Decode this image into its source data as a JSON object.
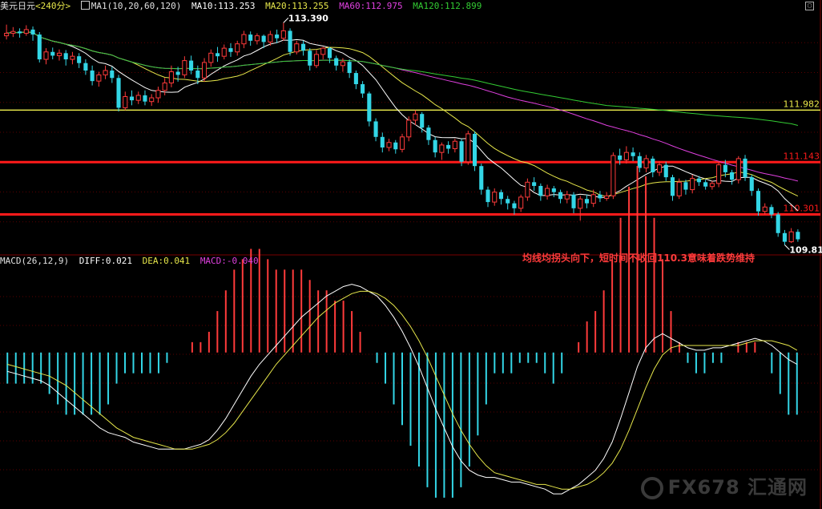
{
  "header": {
    "symbol": "美元日元",
    "period": "<240分>",
    "ma_label": "MA1(10,20,60,120)",
    "ma10": "MA10:113.253",
    "ma20": "MA20:113.255",
    "ma60": "MA60:112.975",
    "ma120": "MA120:112.899"
  },
  "macd_header": {
    "label": "MACD(26,12,9)",
    "diff": "DIFF:0.021",
    "dea": "DEA:0.041",
    "macd": "MACD:-0.040"
  },
  "annotation": "均线均拐头向下，短时间不收回110.3意味着跌势维持",
  "watermark": "FX678 汇通网",
  "colors": {
    "up": "#ff3b3b",
    "down": "#33d6e6",
    "ma10": "#ffffff",
    "ma20": "#e6e64a",
    "ma60": "#e040e0",
    "ma120": "#33cc33",
    "level_yellow": "#e6e64a",
    "level_red": "#ff1a1a",
    "diff": "#ffffff",
    "dea": "#e6e64a"
  },
  "chart_data": [
    {
      "type": "candlestick",
      "ylim": [
        109.7,
        113.55
      ],
      "price_labels": [
        {
          "value": 113.39,
          "text": "113.390"
        },
        {
          "value": 109.81,
          "text": "109.810"
        }
      ],
      "levels": [
        {
          "value": 111.982,
          "text": "111.982",
          "color": "yellow"
        },
        {
          "value": 111.143,
          "text": "111.143",
          "color": "red"
        },
        {
          "value": 110.301,
          "text": "110.301",
          "color": "red"
        }
      ],
      "candles": [
        [
          113.18,
          113.22,
          113.36,
          113.12
        ],
        [
          113.22,
          113.25,
          113.32,
          113.16
        ],
        [
          113.25,
          113.22,
          113.3,
          113.15
        ],
        [
          113.22,
          113.28,
          113.35,
          113.18
        ],
        [
          113.28,
          113.2,
          113.33,
          113.1
        ],
        [
          113.2,
          112.8,
          113.24,
          112.75
        ],
        [
          112.8,
          112.92,
          112.98,
          112.72
        ],
        [
          112.92,
          112.86,
          112.99,
          112.8
        ],
        [
          112.86,
          112.9,
          112.96,
          112.78
        ],
        [
          112.9,
          112.8,
          112.95,
          112.7
        ],
        [
          112.8,
          112.85,
          112.92,
          112.72
        ],
        [
          112.85,
          112.74,
          112.9,
          112.66
        ],
        [
          112.74,
          112.62,
          112.8,
          112.55
        ],
        [
          112.62,
          112.45,
          112.7,
          112.38
        ],
        [
          112.45,
          112.55,
          112.6,
          112.36
        ],
        [
          112.55,
          112.62,
          112.7,
          112.48
        ],
        [
          112.62,
          112.5,
          112.68,
          112.42
        ],
        [
          112.5,
          112.02,
          112.55,
          111.96
        ],
        [
          112.02,
          112.2,
          112.28,
          111.98
        ],
        [
          112.2,
          112.14,
          112.3,
          112.06
        ],
        [
          112.14,
          112.22,
          112.28,
          112.08
        ],
        [
          112.22,
          112.12,
          112.3,
          112.06
        ],
        [
          112.12,
          112.18,
          112.24,
          112.05
        ],
        [
          112.18,
          112.3,
          112.36,
          112.1
        ],
        [
          112.3,
          112.42,
          112.5,
          112.22
        ],
        [
          112.42,
          112.6,
          112.7,
          112.35
        ],
        [
          112.6,
          112.55,
          112.68,
          112.44
        ],
        [
          112.55,
          112.78,
          112.85,
          112.5
        ],
        [
          112.78,
          112.62,
          112.86,
          112.56
        ],
        [
          112.62,
          112.5,
          112.7,
          112.4
        ],
        [
          112.5,
          112.75,
          112.82,
          112.44
        ],
        [
          112.75,
          112.9,
          112.96,
          112.68
        ],
        [
          112.9,
          112.85,
          113.0,
          112.76
        ],
        [
          112.85,
          112.98,
          113.04,
          112.8
        ],
        [
          112.98,
          112.92,
          113.06,
          112.84
        ],
        [
          112.92,
          113.05,
          113.1,
          112.86
        ],
        [
          113.05,
          113.2,
          113.26,
          112.98
        ],
        [
          113.2,
          113.1,
          113.25,
          113.02
        ],
        [
          113.1,
          113.18,
          113.22,
          113.04
        ],
        [
          113.18,
          113.08,
          113.2,
          112.98
        ],
        [
          113.08,
          113.2,
          113.26,
          113.02
        ],
        [
          113.2,
          113.14,
          113.28,
          113.06
        ],
        [
          113.14,
          113.26,
          113.39,
          113.1
        ],
        [
          113.26,
          112.92,
          113.3,
          112.86
        ],
        [
          112.92,
          113.05,
          113.1,
          112.88
        ],
        [
          113.05,
          112.94,
          113.1,
          112.86
        ],
        [
          112.94,
          112.7,
          112.98,
          112.62
        ],
        [
          112.7,
          112.88,
          112.95,
          112.66
        ],
        [
          112.88,
          112.98,
          113.0,
          112.8
        ],
        [
          112.98,
          112.82,
          113.0,
          112.74
        ],
        [
          112.82,
          112.7,
          112.86,
          112.62
        ],
        [
          112.7,
          112.76,
          112.82,
          112.6
        ],
        [
          112.76,
          112.58,
          112.8,
          112.5
        ],
        [
          112.58,
          112.4,
          112.62,
          112.32
        ],
        [
          112.4,
          112.25,
          112.45,
          112.18
        ],
        [
          112.25,
          111.8,
          112.28,
          111.72
        ],
        [
          111.8,
          111.55,
          111.85,
          111.48
        ],
        [
          111.55,
          111.38,
          111.62,
          111.3
        ],
        [
          111.38,
          111.46,
          111.52,
          111.32
        ],
        [
          111.46,
          111.35,
          111.5,
          111.28
        ],
        [
          111.35,
          111.55,
          111.6,
          111.3
        ],
        [
          111.55,
          111.82,
          111.88,
          111.48
        ],
        [
          111.82,
          111.92,
          111.98,
          111.74
        ],
        [
          111.92,
          111.7,
          111.95,
          111.62
        ],
        [
          111.7,
          111.5,
          111.74,
          111.42
        ],
        [
          111.5,
          111.3,
          111.55,
          111.22
        ],
        [
          111.3,
          111.42,
          111.46,
          111.18
        ],
        [
          111.42,
          111.36,
          111.48,
          111.28
        ],
        [
          111.36,
          111.48,
          111.52,
          111.3
        ],
        [
          111.48,
          111.15,
          111.52,
          111.08
        ],
        [
          111.15,
          111.6,
          111.65,
          111.1
        ],
        [
          111.6,
          111.08,
          111.64,
          111.0
        ],
        [
          111.08,
          110.7,
          111.12,
          110.62
        ],
        [
          110.7,
          110.5,
          110.75,
          110.42
        ],
        [
          110.5,
          110.66,
          110.72,
          110.44
        ],
        [
          110.66,
          110.55,
          110.7,
          110.46
        ],
        [
          110.55,
          110.48,
          110.6,
          110.38
        ],
        [
          110.48,
          110.4,
          110.52,
          110.3
        ],
        [
          110.4,
          110.58,
          110.62,
          110.34
        ],
        [
          110.58,
          110.82,
          110.88,
          110.52
        ],
        [
          110.82,
          110.76,
          110.9,
          110.68
        ],
        [
          110.76,
          110.6,
          110.8,
          110.52
        ],
        [
          110.6,
          110.72,
          110.78,
          110.54
        ],
        [
          110.72,
          110.66,
          110.76,
          110.58
        ],
        [
          110.66,
          110.55,
          110.7,
          110.48
        ],
        [
          110.55,
          110.62,
          110.68,
          110.48
        ],
        [
          110.62,
          110.4,
          110.66,
          110.32
        ],
        [
          110.4,
          110.55,
          110.6,
          110.2
        ],
        [
          110.55,
          110.48,
          110.62,
          110.4
        ],
        [
          110.48,
          110.62,
          110.7,
          110.42
        ],
        [
          110.62,
          110.56,
          110.68,
          110.5
        ],
        [
          110.56,
          110.6,
          110.66,
          110.52
        ],
        [
          110.6,
          111.25,
          111.3,
          110.55
        ],
        [
          111.25,
          111.18,
          111.36,
          111.1
        ],
        [
          111.18,
          111.3,
          111.4,
          111.12
        ],
        [
          111.3,
          111.24,
          111.38,
          111.16
        ],
        [
          111.24,
          111.05,
          111.3,
          110.98
        ],
        [
          111.05,
          111.2,
          111.26,
          110.98
        ],
        [
          111.2,
          110.98,
          111.24,
          110.9
        ],
        [
          110.98,
          111.1,
          111.16,
          110.92
        ],
        [
          111.1,
          110.9,
          111.15,
          110.84
        ],
        [
          110.9,
          110.6,
          110.94,
          110.52
        ],
        [
          110.6,
          110.82,
          110.88,
          110.55
        ],
        [
          110.82,
          110.7,
          110.86,
          110.62
        ],
        [
          110.7,
          110.88,
          110.94,
          110.64
        ],
        [
          110.88,
          110.82,
          110.92,
          110.76
        ],
        [
          110.82,
          110.75,
          110.86,
          110.7
        ],
        [
          110.75,
          110.8,
          110.84,
          110.7
        ],
        [
          110.8,
          111.1,
          111.16,
          110.74
        ],
        [
          111.1,
          110.98,
          111.18,
          110.9
        ],
        [
          110.98,
          110.86,
          111.02,
          110.78
        ],
        [
          110.86,
          111.2,
          111.24,
          110.8
        ],
        [
          111.2,
          110.9,
          111.26,
          110.84
        ],
        [
          110.9,
          110.68,
          110.94,
          110.6
        ],
        [
          110.68,
          110.35,
          110.72,
          110.28
        ],
        [
          110.35,
          110.42,
          110.48,
          110.3
        ],
        [
          110.42,
          110.3,
          110.46,
          110.24
        ],
        [
          110.3,
          110.0,
          110.34,
          109.94
        ],
        [
          110.0,
          109.86,
          110.05,
          109.81
        ],
        [
          109.86,
          110.02,
          110.08,
          109.84
        ],
        [
          110.02,
          109.9,
          110.06,
          109.86
        ]
      ]
    },
    {
      "type": "macd",
      "ylim": [
        -0.62,
        0.36
      ],
      "diff": [
        -0.08,
        -0.09,
        -0.1,
        -0.11,
        -0.12,
        -0.14,
        -0.17,
        -0.2,
        -0.23,
        -0.26,
        -0.29,
        -0.32,
        -0.34,
        -0.35,
        -0.36,
        -0.38,
        -0.39,
        -0.4,
        -0.41,
        -0.41,
        -0.41,
        -0.41,
        -0.4,
        -0.39,
        -0.37,
        -0.33,
        -0.28,
        -0.22,
        -0.16,
        -0.1,
        -0.05,
        -0.01,
        0.03,
        0.07,
        0.11,
        0.15,
        0.18,
        0.21,
        0.24,
        0.26,
        0.28,
        0.29,
        0.28,
        0.26,
        0.24,
        0.2,
        0.15,
        0.09,
        0.02,
        -0.06,
        -0.15,
        -0.24,
        -0.32,
        -0.4,
        -0.46,
        -0.5,
        -0.52,
        -0.53,
        -0.53,
        -0.54,
        -0.55,
        -0.55,
        -0.56,
        -0.57,
        -0.58,
        -0.6,
        -0.6,
        -0.58,
        -0.56,
        -0.53,
        -0.5,
        -0.45,
        -0.38,
        -0.28,
        -0.17,
        -0.06,
        0.02,
        0.06,
        0.08,
        0.06,
        0.04,
        0.02,
        0.01,
        0.01,
        0.02,
        0.02,
        0.03,
        0.04,
        0.05,
        0.06,
        0.05,
        0.03,
        0.0,
        -0.03,
        -0.05
      ],
      "dea": [
        -0.05,
        -0.06,
        -0.07,
        -0.08,
        -0.09,
        -0.1,
        -0.12,
        -0.14,
        -0.17,
        -0.2,
        -0.23,
        -0.26,
        -0.29,
        -0.32,
        -0.34,
        -0.36,
        -0.37,
        -0.38,
        -0.39,
        -0.4,
        -0.41,
        -0.41,
        -0.41,
        -0.4,
        -0.39,
        -0.37,
        -0.34,
        -0.3,
        -0.25,
        -0.2,
        -0.15,
        -0.1,
        -0.05,
        -0.01,
        0.03,
        0.07,
        0.11,
        0.15,
        0.18,
        0.21,
        0.23,
        0.25,
        0.26,
        0.26,
        0.25,
        0.23,
        0.2,
        0.16,
        0.11,
        0.05,
        -0.02,
        -0.1,
        -0.18,
        -0.26,
        -0.33,
        -0.39,
        -0.44,
        -0.48,
        -0.51,
        -0.52,
        -0.53,
        -0.54,
        -0.55,
        -0.56,
        -0.56,
        -0.57,
        -0.58,
        -0.58,
        -0.57,
        -0.56,
        -0.54,
        -0.51,
        -0.47,
        -0.41,
        -0.33,
        -0.24,
        -0.15,
        -0.07,
        -0.01,
        0.02,
        0.03,
        0.03,
        0.03,
        0.03,
        0.03,
        0.03,
        0.03,
        0.03,
        0.04,
        0.05,
        0.05,
        0.05,
        0.04,
        0.03,
        0.01
      ]
    }
  ]
}
